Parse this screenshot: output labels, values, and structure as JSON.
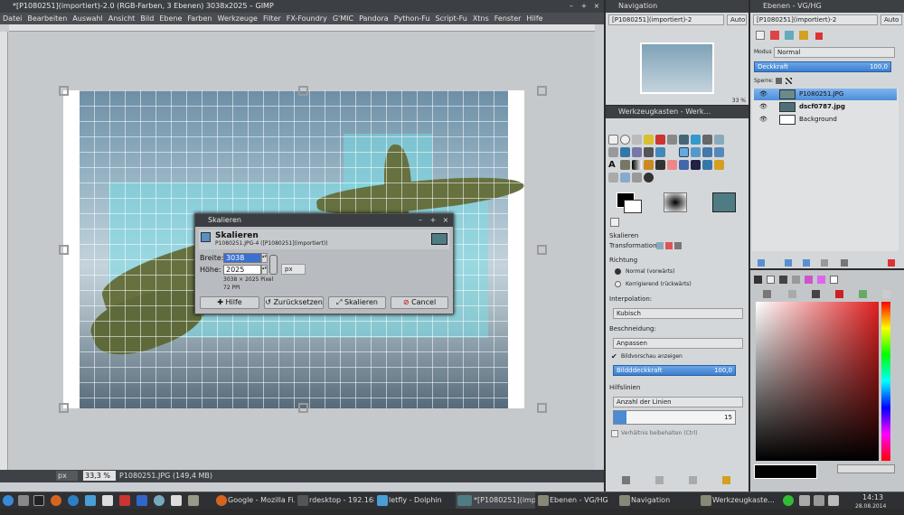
{
  "gimp": {
    "title": "*[P1080251](importiert)-2.0 (RGB-Farben, 3 Ebenen) 3038x2025 – GIMP",
    "menu": [
      "Datei",
      "Bearbeiten",
      "Auswahl",
      "Ansicht",
      "Bild",
      "Ebene",
      "Farben",
      "Werkzeuge",
      "Filter",
      "FX-Foundry",
      "G'MIC",
      "Pandora",
      "Python-Fu",
      "Script-Fu",
      "Xtns",
      "Fenster",
      "Hilfe"
    ],
    "status": {
      "unit": "px",
      "zoom": "33,3 %",
      "info": "P1080251.JPG (149,4 MB)"
    }
  },
  "dialog": {
    "title": "Skalieren",
    "heading": "Skalieren",
    "subtitle": "P1080251.JPG-4 ([P1080251](importiert))",
    "width_label": "Breite:",
    "width_value": "3038",
    "height_label": "Höhe:",
    "height_value": "2025",
    "unit": "px",
    "pixels": "3038 × 2025 Pixel",
    "ppi": "72 PPI",
    "buttons": {
      "help": "Hilfe",
      "reset": "Zurücksetzen",
      "scale": "Skalieren",
      "cancel": "Cancel"
    }
  },
  "navigation": {
    "title": "Navigation",
    "dropdown": "[P1080251](importiert)-2",
    "auto": "Auto",
    "zoom": "33 %"
  },
  "toolbox": {
    "title": "Werkzeugkasten - Werk...",
    "section": "Skalieren",
    "transformation": "Transformation:",
    "direction_label": "Richtung",
    "direction_normal": "Normal (vorwärts)",
    "direction_corrective": "Korrigierend (rückwärts)",
    "interpolation_label": "Interpolation:",
    "interpolation_value": "Kubisch",
    "clipping_label": "Beschneidung:",
    "clipping_value": "Anpassen",
    "preview_label": "Bildvorschau anzeigen",
    "opacity_label": "Bildddeckkraft",
    "opacity_value": "100,0",
    "guides_label": "Hilfslinien",
    "guides_value": "Anzahl der Linien",
    "lines_value": "15",
    "keep_ratio": "Verhältnis beibehalten (Ctrl)"
  },
  "layers": {
    "title": "Ebenen - VG/HG",
    "dropdown": "[P1080251](importiert)-2",
    "auto": "Auto",
    "mode_label": "Modus",
    "mode_value": "Normal",
    "opacity_label": "Deckkraft",
    "opacity_value": "100,0",
    "lock_label": "Sperre:",
    "items": [
      {
        "name": "P1080251.JPG"
      },
      {
        "name": "dscf0787.jpg"
      },
      {
        "name": "Background"
      }
    ]
  },
  "taskbar": {
    "tasks": [
      "Google - Mozilla Fi...",
      "rdesktop - 192.168...",
      "letfly - Dolphin",
      "*[P1080251](importi...",
      "Ebenen - VG/HG",
      "Navigation",
      "Werkzeugkaste..."
    ],
    "time": "14:13",
    "date": "28.08.2014"
  }
}
